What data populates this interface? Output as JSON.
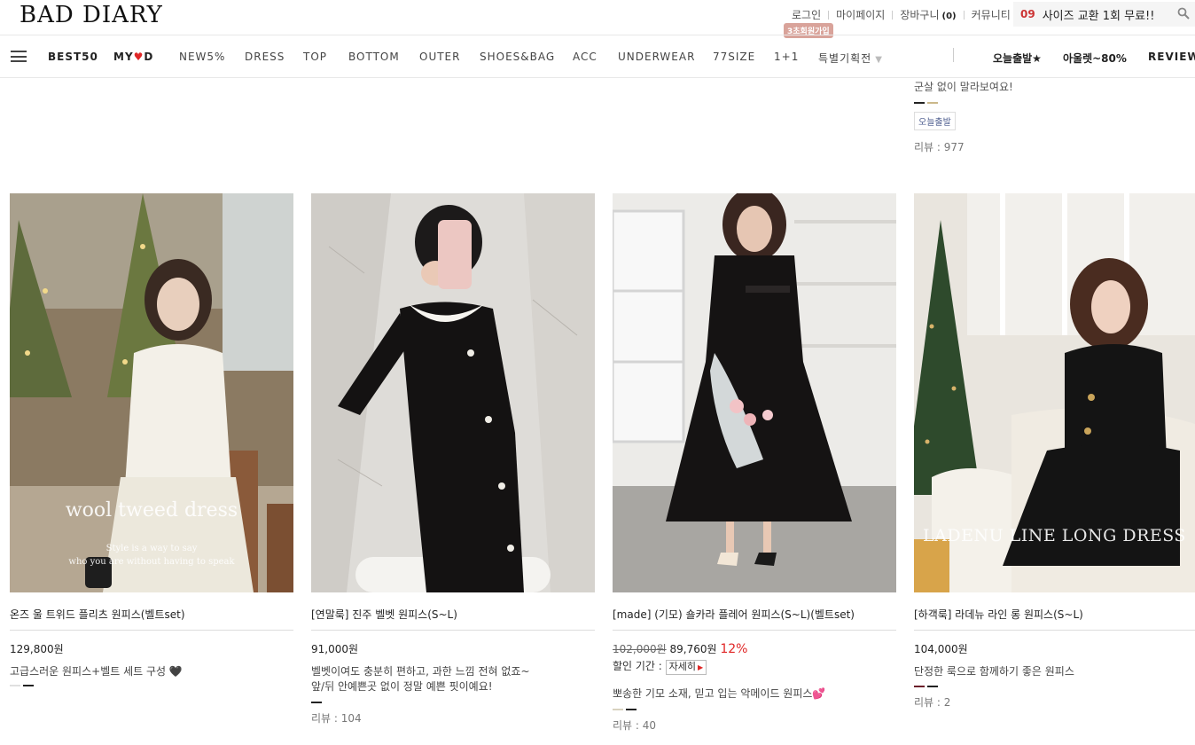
{
  "header": {
    "logo": "BAD DIARY",
    "links": {
      "login": "로그인",
      "mypage": "마이페이지",
      "cart": "장바구니",
      "cart_count": "(0)",
      "community": "커뮤니티"
    },
    "signup_badge": "3초회원가입",
    "promo": {
      "number": "09",
      "text": "사이즈 교환 1회 무료!!"
    }
  },
  "nav": {
    "items": [
      "BEST50",
      "MY",
      "D",
      "NEW5%",
      "DRESS",
      "TOP",
      "BOTTOM",
      "OUTER",
      "SHOES&BAG",
      "ACC",
      "UNDERWEAR",
      "77SIZE",
      "1+1",
      "특별기획전"
    ],
    "right": [
      "오늘출발★",
      "아울렛~80%",
      "REVIEW"
    ],
    "heart": "♥",
    "caret": "▼"
  },
  "previous_item": {
    "desc": "군살 없이 말라보여요!",
    "tag": "오늘출발",
    "review": "리뷰 : 977"
  },
  "products": [
    {
      "name": "온즈 울 트위드 플리츠 원피스(벨트set)",
      "price": "129,800원",
      "desc_line1": "고급스러운 원피스+벨트 세트 구성 🖤",
      "desc_line2": "",
      "overlay_title": "wool tweed dress",
      "overlay_sub1": "Style is a way to say",
      "overlay_sub2": "who you are without having to speak",
      "review": "",
      "colors": [
        "#e0e0e0",
        "#222222"
      ]
    },
    {
      "name": "[연말룩] 진주 벨벳 원피스(S~L)",
      "price": "91,000원",
      "desc_line1": "벨벳이여도 충분히 편하고, 과한 느낌 전혀 없죠~",
      "desc_line2": "앞/뒤 안예쁜곳 없이 정말 예쁜 핏이예요!",
      "review": "리뷰 : 104",
      "colors": [
        "#222222"
      ]
    },
    {
      "name": "[made] (기모) 숄카라 플레어 원피스(S~L)(벨트set)",
      "original_price": "102,000원",
      "price": "89,760원",
      "discount": "12%",
      "sale_period_label": "할인 기간 :",
      "detail_button": "자세히",
      "desc_line1": "뽀송한 기모 소재, 믿고 입는 악메이드 원피스💕",
      "desc_line2": "",
      "review": "리뷰 : 40",
      "colors": [
        "#d8d2bf",
        "#222222"
      ]
    },
    {
      "name": "[하객룩] 라데뉴 라인 롱 원피스(S~L)",
      "price": "104,000원",
      "desc_line1": "단정한 룩으로 함께하기 좋은 원피스",
      "desc_line2": "",
      "overlay_title": "LADENU LINE LONG DRESS",
      "review": "리뷰 : 2",
      "colors": [
        "#6b1f2a",
        "#222222"
      ]
    }
  ],
  "colors": {
    "accent_red": "#e02626",
    "badge": "#d9a39a",
    "promo_bg": "#f5f5f5"
  }
}
